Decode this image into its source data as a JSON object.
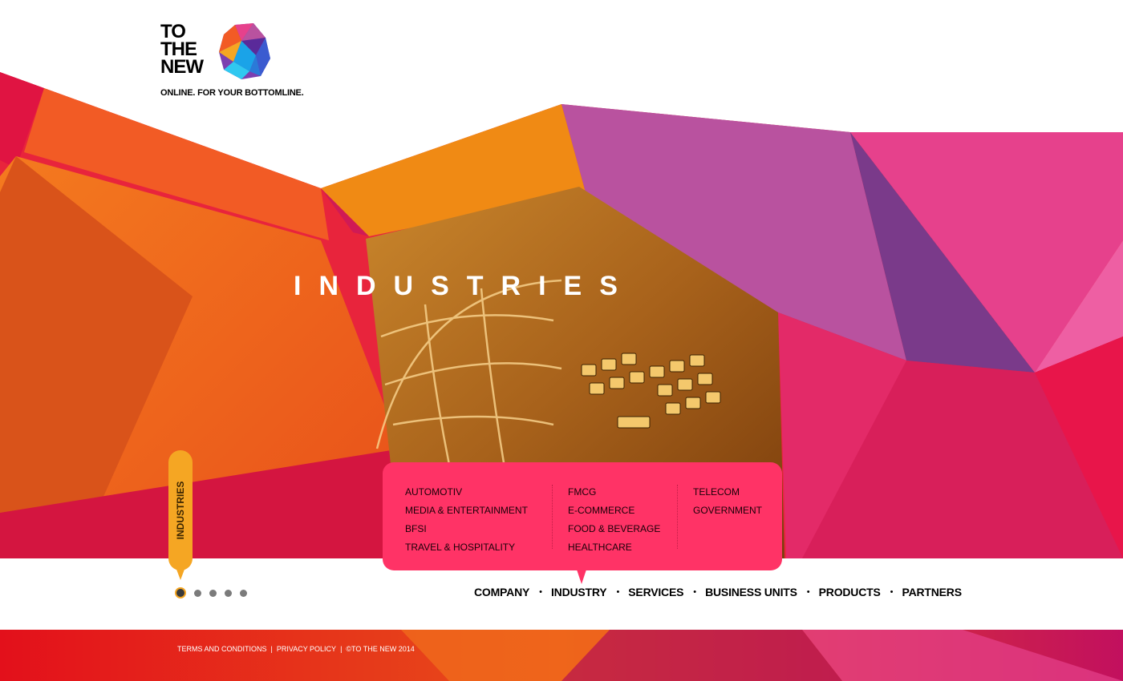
{
  "brand": {
    "logo_lines": [
      "TO",
      "THE",
      "NEW"
    ],
    "tagline": "ONLINE. FOR YOUR BOTTOMLINE."
  },
  "hero": {
    "title": "INDUSTRIES",
    "side_tab_label": "INDUSTRIES"
  },
  "carousel": {
    "dot_count": 5,
    "active_index": 0
  },
  "industries_menu": {
    "col1": [
      "AUTOMOTIV",
      "MEDIA & ENTERTAINMENT",
      "BFSI",
      "TRAVEL & HOSPITALITY"
    ],
    "col2": [
      "FMCG",
      "E-COMMERCE",
      "FOOD & BEVERAGE",
      "HEALTHCARE"
    ],
    "col3": [
      "TELECOM",
      "GOVERNMENT"
    ]
  },
  "nav": {
    "items": [
      "COMPANY",
      "INDUSTRY",
      "SERVICES",
      "BUSINESS UNITS",
      "PRODUCTS",
      "PARTNERS"
    ],
    "active": "INDUSTRY",
    "separator": "•"
  },
  "footer": {
    "terms": "TERMS AND CONDITIONS",
    "privacy": "PRIVACY POLICY",
    "copyright": "©TO THE NEW 2014",
    "separator": "|"
  },
  "colors": {
    "accent_pink": "#ff3366",
    "accent_orange": "#f5a623",
    "footer_red": "#e3101b"
  }
}
